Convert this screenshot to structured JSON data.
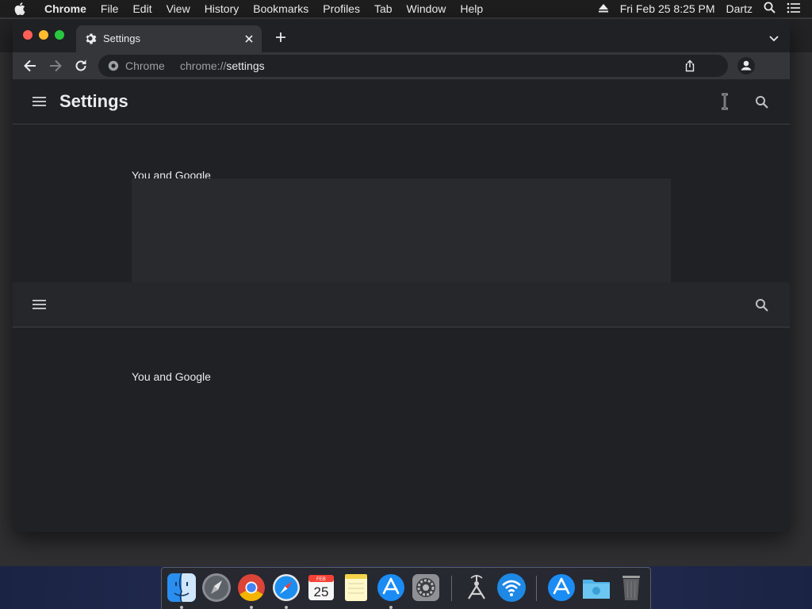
{
  "menubar": {
    "app_name": "Chrome",
    "items": [
      "File",
      "Edit",
      "View",
      "History",
      "Bookmarks",
      "Profiles",
      "Tab",
      "Window",
      "Help"
    ],
    "clock": "Fri Feb 25  8:25 PM",
    "user": "Dartz"
  },
  "tab": {
    "title": "Settings",
    "icon": "gear-icon"
  },
  "omnibox": {
    "site_label": "Chrome",
    "url_scheme": "chrome://",
    "url_path": "settings"
  },
  "settings": {
    "title": "Settings",
    "section_title": "You and Google"
  },
  "dock": {
    "apps": [
      "Finder",
      "Launchpad",
      "Google Chrome",
      "Safari",
      "Calendar",
      "Notes",
      "App Store",
      "System Preferences",
      "Wireless Diagnostics",
      "Wi-Fi",
      "App Store",
      "Downloads",
      "Trash"
    ],
    "calendar_day": "25",
    "calendar_month": "FEB"
  },
  "colors": {
    "background": "#202124",
    "toolbar": "#35363a",
    "text": "#e8eaed",
    "muted_text": "#9aa0a6"
  }
}
